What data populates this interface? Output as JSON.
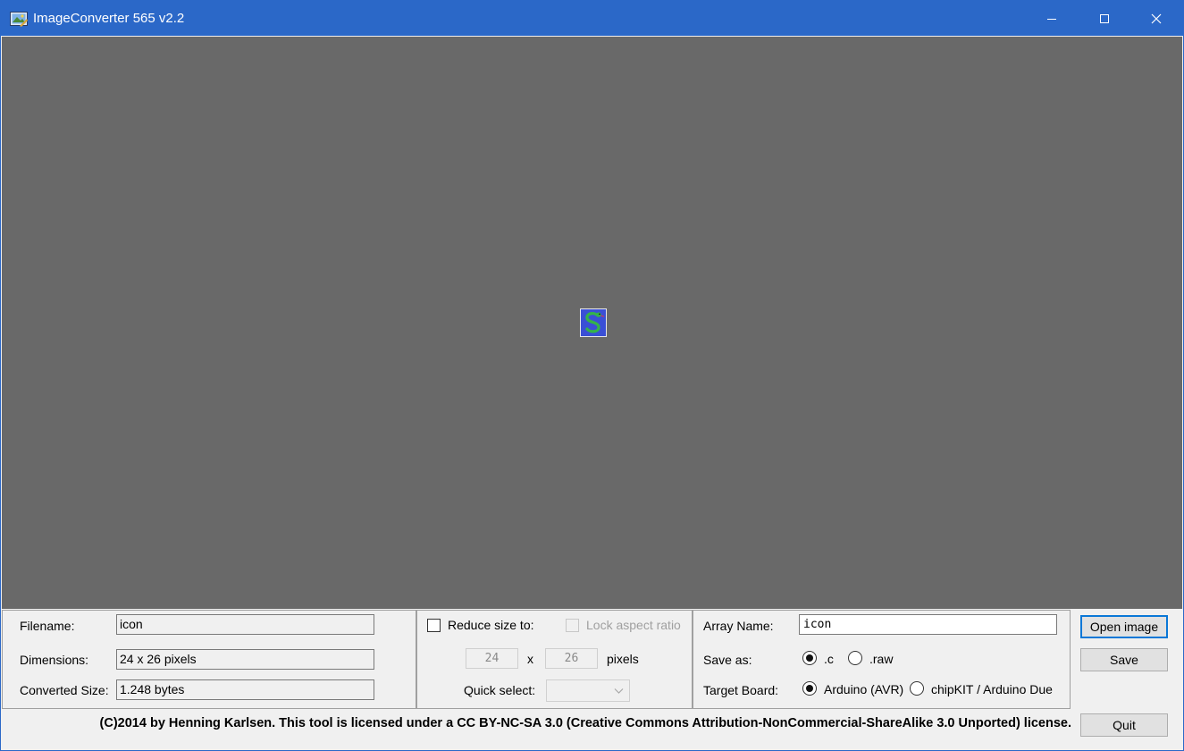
{
  "window": {
    "title": "ImageConverter 565 v2.2",
    "icons": {
      "app": "app-icon",
      "minimize": "minimize-icon",
      "maximize": "maximize-icon",
      "close": "close-icon"
    }
  },
  "colors": {
    "titlebar": "#2b68c8",
    "canvas": "#696969",
    "focus": "#0a78d7"
  },
  "file_info": {
    "filename_label": "Filename:",
    "filename_value": "icon",
    "dimensions_label": "Dimensions:",
    "dimensions_value": "24 x 26 pixels",
    "converted_label": "Converted Size:",
    "converted_value": "1.248 bytes"
  },
  "resize": {
    "reduce_label": "Reduce size to:",
    "reduce_checked": false,
    "lock_label": "Lock aspect ratio",
    "lock_checked": false,
    "width_value": "24",
    "times": "x",
    "height_value": "26",
    "pixels_label": "pixels",
    "quick_select_label": "Quick select:",
    "quick_select_value": ""
  },
  "output": {
    "array_name_label": "Array Name:",
    "array_name_value": "icon",
    "save_as_label": "Save as:",
    "save_as_options": [
      ".c",
      ".raw"
    ],
    "save_as_selected": ".c",
    "target_label": "Target Board:",
    "target_options": [
      "Arduino (AVR)",
      "chipKIT / Arduino Due"
    ],
    "target_selected": "Arduino (AVR)"
  },
  "buttons": {
    "open": "Open image",
    "save": "Save",
    "quit": "Quit"
  },
  "license": "(C)2014 by Henning Karlsen. This tool is licensed under a CC BY-NC-SA 3.0 (Creative Commons Attribution-NonCommercial-ShareAlike 3.0 Unported) license."
}
